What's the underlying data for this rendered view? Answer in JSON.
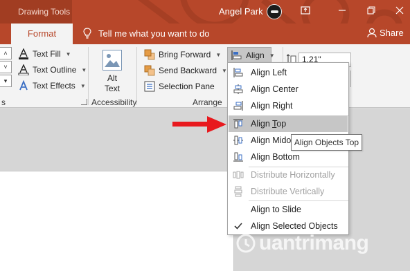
{
  "titlebar": {
    "tools_label": "Drawing Tools",
    "user_name": "Angel Park"
  },
  "tabs": {
    "format": "Format",
    "tell_me": "Tell me what you want to do",
    "share": "Share"
  },
  "ribbon": {
    "text_fill": "Text Fill",
    "text_outline": "Text Outline",
    "text_effects": "Text Effects",
    "alt_text_line1": "Alt",
    "alt_text_line2": "Text",
    "accessibility": "Accessibility",
    "bring_forward": "Bring Forward",
    "send_backward": "Send Backward",
    "selection_pane": "Selection Pane",
    "arrange": "Arrange",
    "align": "Align",
    "size_value": "1.21\"",
    "group_stub": "s"
  },
  "align_menu": {
    "items": [
      {
        "label": "Align Left",
        "icon": "align-left-icon"
      },
      {
        "label": "Align Center",
        "icon": "align-center-icon"
      },
      {
        "label": "Align Right",
        "icon": "align-right-icon"
      },
      {
        "label": "Align Top",
        "icon": "align-top-icon",
        "highlighted": true
      },
      {
        "label": "Align Middle",
        "icon": "align-middle-icon"
      },
      {
        "label": "Align Bottom",
        "icon": "align-bottom-icon"
      },
      {
        "label": "Distribute Horizontally",
        "icon": "distribute-horizontal-icon",
        "disabled": true
      },
      {
        "label": "Distribute Vertically",
        "icon": "distribute-vertical-icon",
        "disabled": true
      },
      {
        "label": "Align to Slide",
        "icon": ""
      },
      {
        "label": "Align Selected Objects",
        "icon": "checkmark-icon",
        "checked": true
      }
    ],
    "visible_middle": "Align Mido"
  },
  "tooltip": "Align Objects Top",
  "watermark": "uantrimang",
  "colors": {
    "accent": "#b7472a",
    "highlight": "#c6c6c6",
    "arrow": "#e8191e"
  }
}
